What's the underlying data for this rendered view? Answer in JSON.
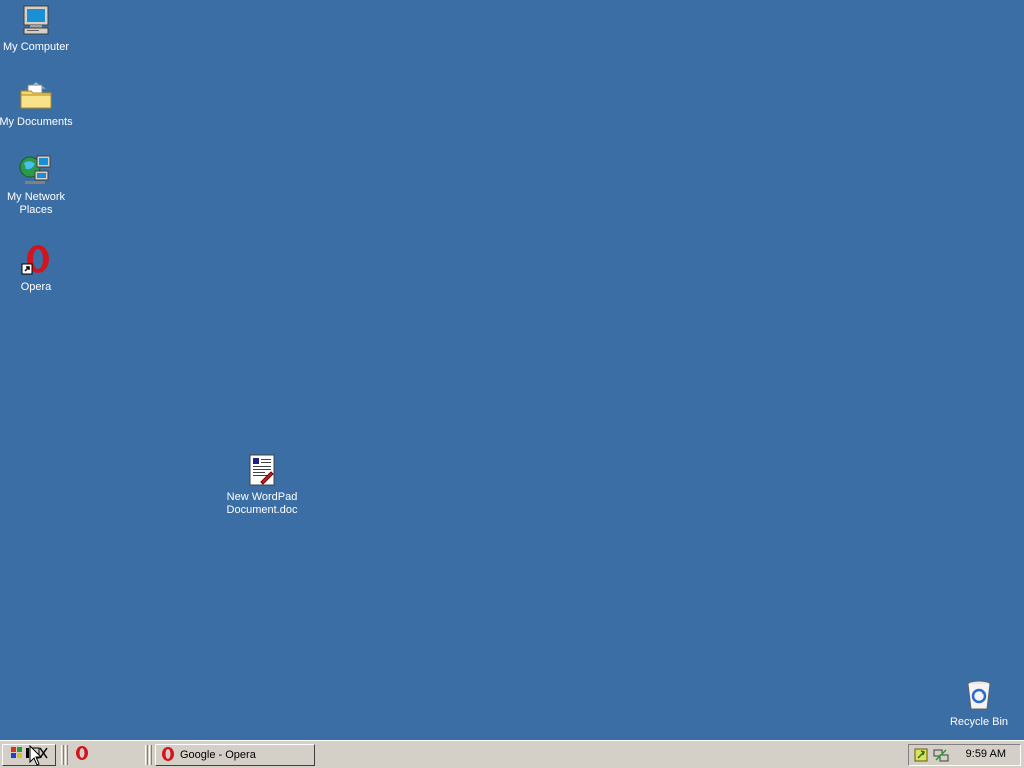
{
  "desktop": {
    "background": "#3a6ea5",
    "icons": [
      {
        "label": "My Computer",
        "icon": "computer-icon"
      },
      {
        "label": "My Documents",
        "icon": "folder-icon"
      },
      {
        "label": "My Network\nPlaces",
        "icon": "network-icon"
      },
      {
        "label": "Opera",
        "icon": "opera-shortcut-icon"
      },
      {
        "label": "New WordPad\nDocument.doc",
        "icon": "wordpad-document-icon"
      },
      {
        "label": "Recycle Bin",
        "icon": "recycle-bin-icon"
      }
    ]
  },
  "taskbar": {
    "start_icon": "start-flag-icon",
    "quick_launch": [
      {
        "icon": "opera-icon"
      }
    ],
    "tasks": [
      {
        "label": "Google - Opera",
        "icon": "opera-icon"
      }
    ],
    "tray": {
      "icons": [
        "network-tray-icon",
        "connection-tray-icon"
      ],
      "clock": "9:59 AM"
    }
  }
}
